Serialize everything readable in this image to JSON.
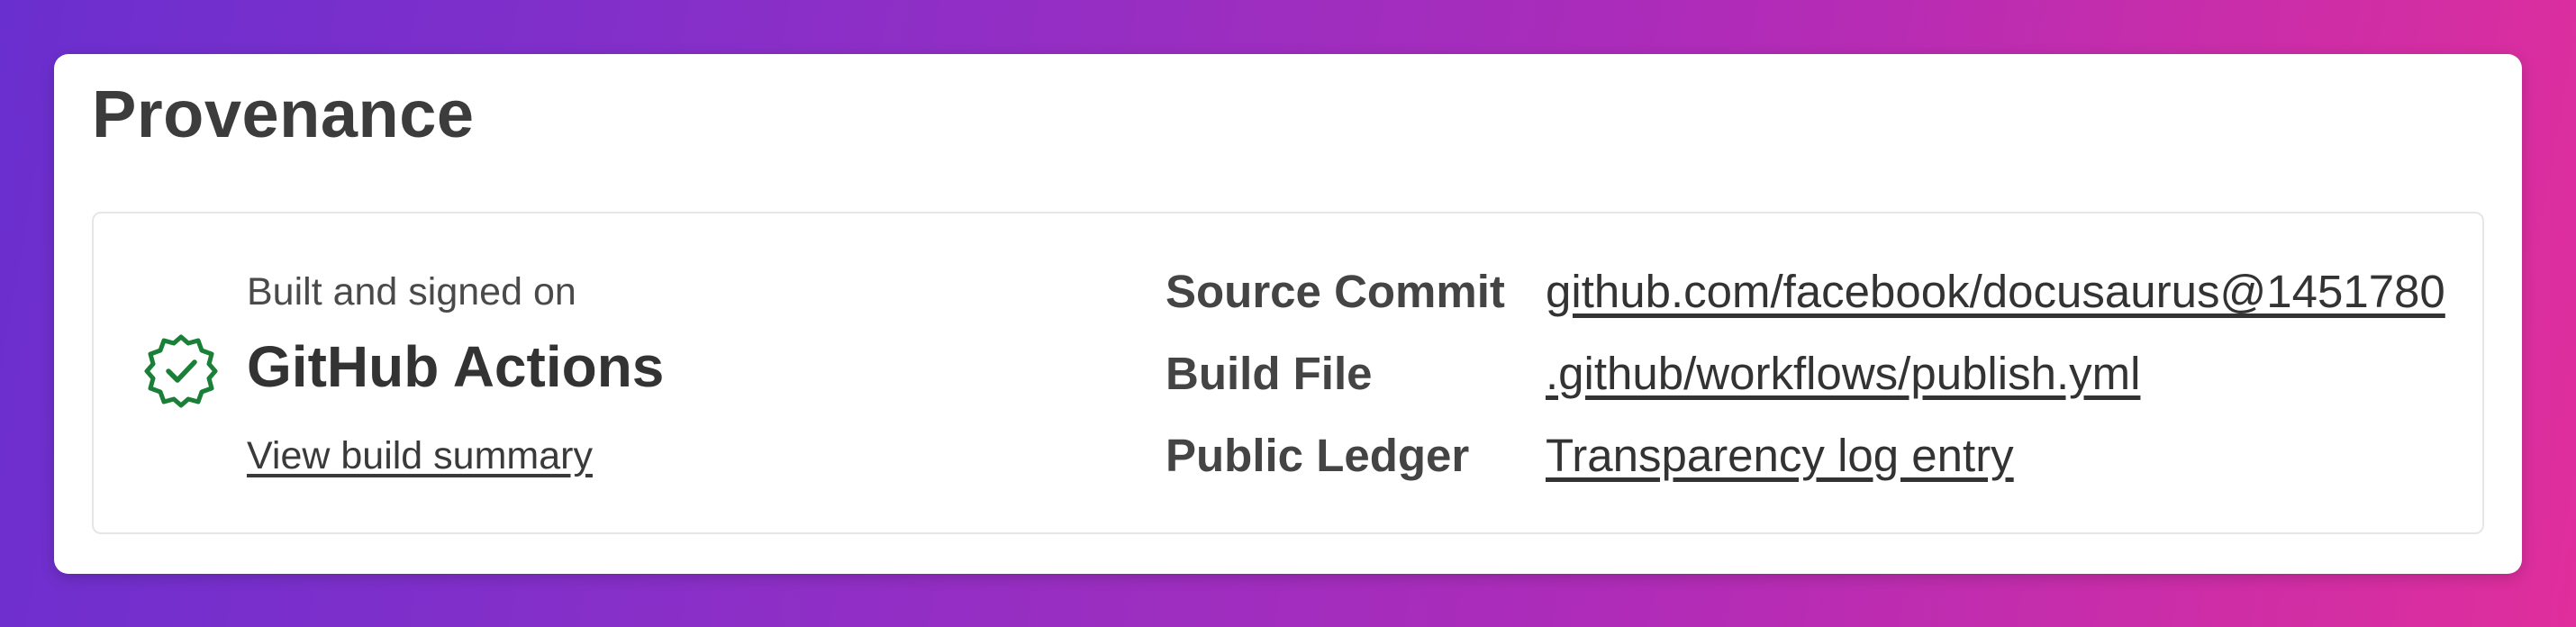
{
  "title": "Provenance",
  "summary": {
    "built_label": "Built and signed on",
    "platform": "GitHub Actions",
    "view_summary_link": "View build summary",
    "status_icon": "verified-check-badge-icon",
    "status_color": "#1a7f37"
  },
  "details": [
    {
      "label": "Source Commit",
      "value": "github.com/facebook/docusaurus@1451780"
    },
    {
      "label": "Build File",
      "value": ".github/workflows/publish.yml"
    },
    {
      "label": "Public Ledger",
      "value": "Transparency log entry"
    }
  ]
}
